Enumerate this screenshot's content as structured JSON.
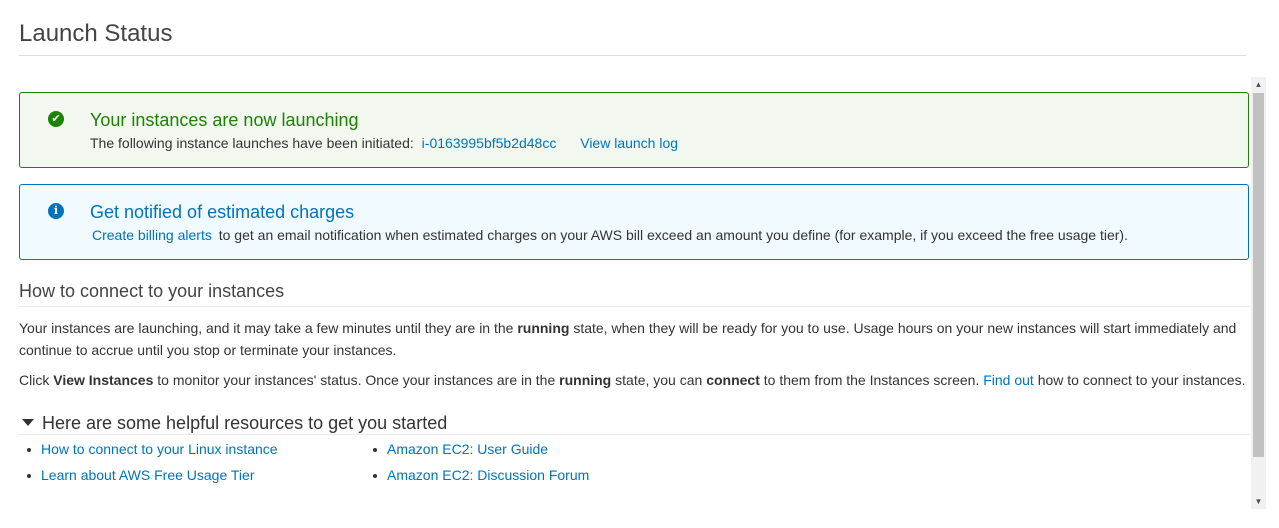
{
  "page": {
    "title": "Launch Status"
  },
  "success_alert": {
    "icon": "check-circle-icon",
    "heading": "Your instances are now launching",
    "body_prefix": "The following instance launches have been initiated:",
    "instance_id": "i-0163995bf5b2d48cc",
    "view_log_label": "View launch log"
  },
  "info_alert": {
    "icon": "info-circle-icon",
    "heading": "Get notified of estimated charges",
    "link_label": "Create billing alerts",
    "body_suffix": "to get an email notification when estimated charges on your AWS bill exceed an amount you define (for example, if you exceed the free usage tier)."
  },
  "connect_section": {
    "heading": "How to connect to your instances",
    "para1_a": "Your instances are launching, and it may take a few minutes until they are in the ",
    "para1_bold": "running",
    "para1_b": " state, when they will be ready for you to use. Usage hours on your new instances will start immediately and continue to accrue until you stop or terminate your instances.",
    "para2_a": "Click ",
    "para2_bold1": "View Instances",
    "para2_b": " to monitor your instances' status. Once your instances are in the ",
    "para2_bold2": "running",
    "para2_c": " state, you can ",
    "para2_bold3": "connect",
    "para2_d": " to them from the Instances screen. ",
    "find_out_label": "Find out",
    "para2_e": " how to connect to your instances."
  },
  "resources": {
    "heading": "Here are some helpful resources to get you started",
    "col1": [
      {
        "label": "How to connect to your Linux instance"
      },
      {
        "label": "Learn about AWS Free Usage Tier"
      }
    ],
    "col2": [
      {
        "label": "Amazon EC2: User Guide"
      },
      {
        "label": "Amazon EC2: Discussion Forum"
      }
    ]
  },
  "colors": {
    "success": "#1d8102",
    "info": "#0073bb",
    "link": "#0073bb"
  }
}
